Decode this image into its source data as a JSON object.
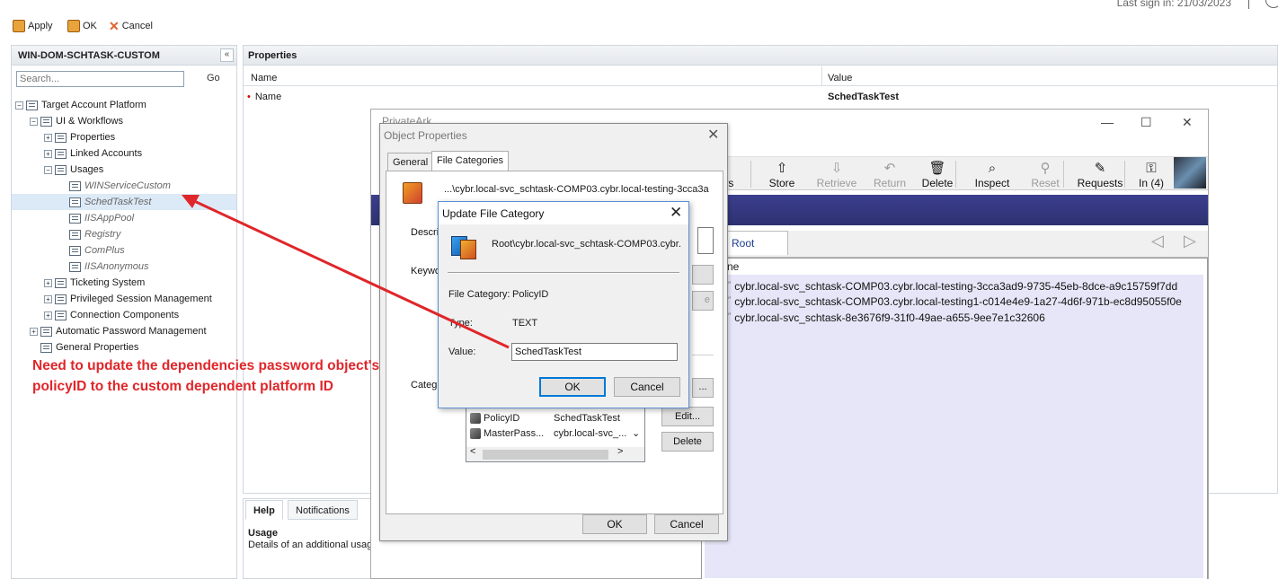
{
  "toolbar": {
    "apply_label": "Apply",
    "ok_label": "OK",
    "cancel_label": "Cancel",
    "signin_text": "Last sign in: 21/03/2023"
  },
  "left_panel": {
    "title": "WIN-DOM-SCHTASK-CUSTOM",
    "collapse_glyph": "«",
    "search_placeholder": "Search...",
    "go_label": "Go",
    "tree": [
      {
        "label": "Target Account Platform",
        "pm": "⊟"
      },
      {
        "label": "UI & Workflows",
        "pm": "⊟"
      },
      {
        "label": "Properties",
        "pm": "⊞"
      },
      {
        "label": "Linked Accounts",
        "pm": "⊞"
      },
      {
        "label": "Usages",
        "pm": "⊟"
      },
      {
        "label": "WINServiceCustom"
      },
      {
        "label": "SchedTaskTest"
      },
      {
        "label": "IISAppPool"
      },
      {
        "label": "Registry"
      },
      {
        "label": "ComPlus"
      },
      {
        "label": "IISAnonymous"
      },
      {
        "label": "Ticketing System",
        "pm": "⊞"
      },
      {
        "label": "Privileged Session Management",
        "pm": "⊞"
      },
      {
        "label": "Connection Components",
        "pm": "⊞"
      },
      {
        "label": "Automatic Password Management",
        "pm": "⊞"
      },
      {
        "label": "General Properties"
      }
    ]
  },
  "properties": {
    "title": "Properties",
    "col_name": "Name",
    "col_value": "Value",
    "row_name": "Name",
    "row_value": "SchedTaskTest"
  },
  "help": {
    "tab_help": "Help",
    "tab_notifications": "Notifications",
    "title": "Usage",
    "text": "Details of an additional usag"
  },
  "privateark": {
    "title": "PrivateArk",
    "min": "—",
    "max": "☐",
    "close": "✕",
    "tools": [
      {
        "label": "ers",
        "icon": "",
        "disabled": false
      },
      {
        "label": "Store",
        "icon": "⇧",
        "disabled": false
      },
      {
        "label": "Retrieve",
        "icon": "⇩",
        "disabled": true
      },
      {
        "label": "Return",
        "icon": "↶",
        "disabled": true
      },
      {
        "label": "Delete",
        "icon": "🗑",
        "disabled": false
      },
      {
        "label": "Inspect",
        "icon": "⌕",
        "disabled": false
      },
      {
        "label": "Reset",
        "icon": "⚲",
        "disabled": true
      },
      {
        "label": "Requests",
        "icon": "✎",
        "disabled": false
      },
      {
        "label": "In (4)",
        "icon": "⚿",
        "disabled": false
      }
    ],
    "root_tab": "Root",
    "nav_prev": "◁",
    "nav_next": "▷",
    "list_header": "ne",
    "files": [
      "cybr.local-svc_schtask-COMP03.cybr.local-testing-3cca3ad9-9735-45eb-8dce-a9c15759f7dd",
      "cybr.local-svc_schtask-COMP03.cybr.local-testing1-c014e4e9-1a27-4d6f-971b-ec8d95055f0e",
      "cybr.local-svc_schtask-8e3676f9-31f0-49ae-a655-9ee7e1c32606"
    ]
  },
  "object_properties": {
    "title": "Object Properties",
    "close": "✕",
    "tab_general": "General",
    "tab_file_categories": "File Categories",
    "path": "...\\cybr.local-svc_schtask-COMP03.cybr.local-testing-3cca3a",
    "desc_label": "Descri",
    "keyw_label": "Keywo",
    "categ_label": "Categ",
    "side_btn_text": "e",
    "edit_label": "Edit...",
    "delete_label": "Delete",
    "add_label": "...",
    "categories": [
      {
        "name": "PolicyID",
        "value": "SchedTaskTest"
      },
      {
        "name": "MasterPass...",
        "value": "cybr.local-svc_..."
      }
    ],
    "scroll_up": "⌄",
    "scroll_left": "<",
    "scroll_right": ">",
    "ok_label": "OK",
    "cancel_label": "Cancel"
  },
  "update_file_category": {
    "title": "Update File Category",
    "close": "✕",
    "path": "Root\\cybr.local-svc_schtask-COMP03.cybr.",
    "file_category_label": "File Category:",
    "file_category_value": "PolicyID",
    "type_label": "Type:",
    "type_value": "TEXT",
    "value_label": "Value:",
    "value_input": "SchedTaskTest",
    "ok_label": "OK",
    "cancel_label": "Cancel"
  },
  "annotation": {
    "line1": "Need to update the dependencies password object's",
    "line2": "policyID to the custom dependent platform ID",
    "color": "#e0262a"
  }
}
